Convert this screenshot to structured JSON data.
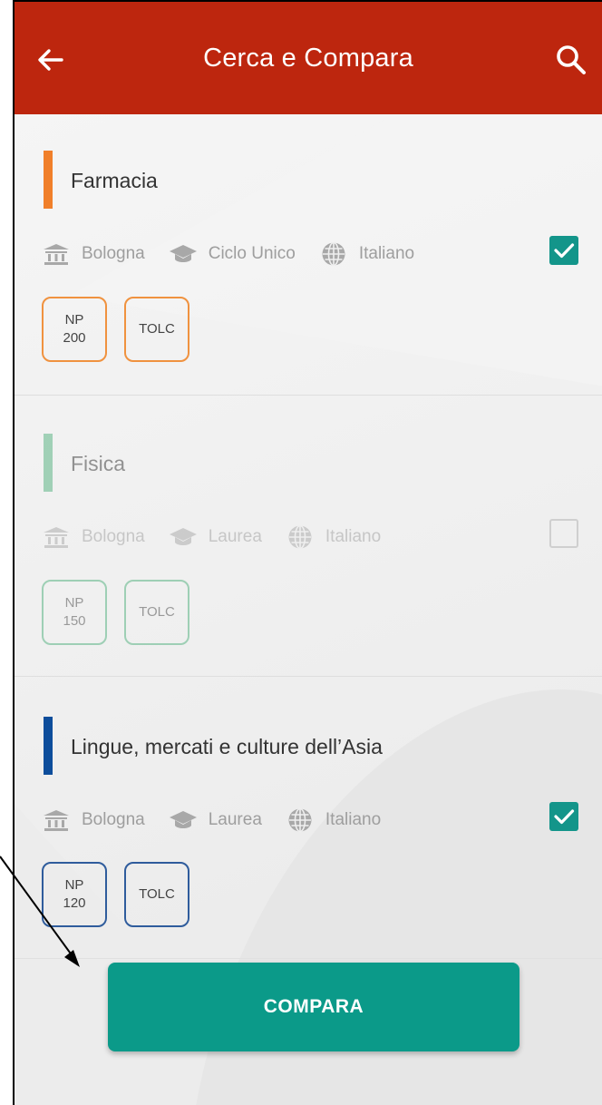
{
  "header": {
    "title": "Cerca e Compara",
    "back_icon": "arrow-left-icon",
    "search_icon": "search-icon",
    "color": "#bd260e"
  },
  "courses": [
    {
      "name": "Farmacia",
      "accent": "#f07f2a",
      "city": "Bologna",
      "degree": "Ciclo Unico",
      "language": "Italiano",
      "checked": true,
      "badges": [
        {
          "line1": "NP",
          "line2": "200"
        },
        {
          "line1": "TOLC",
          "line2": ""
        }
      ]
    },
    {
      "name": "Fisica",
      "accent": "#4fb07c",
      "city": "Bologna",
      "degree": "Laurea",
      "language": "Italiano",
      "checked": false,
      "badges": [
        {
          "line1": "NP",
          "line2": "150"
        },
        {
          "line1": "TOLC",
          "line2": ""
        }
      ]
    },
    {
      "name": "Lingue, mercati e culture dell’Asia",
      "accent": "#0d4d9b",
      "city": "Bologna",
      "degree": "Laurea",
      "language": "Italiano",
      "checked": true,
      "badges": [
        {
          "line1": "NP",
          "line2": "120"
        },
        {
          "line1": "TOLC",
          "line2": ""
        }
      ]
    }
  ],
  "compare_button": {
    "label": "COMPARA",
    "color": "#0b9a89"
  },
  "icons": {
    "city": "museum-icon",
    "degree": "graduation-cap-icon",
    "language": "globe-icon",
    "check": "check-icon"
  }
}
